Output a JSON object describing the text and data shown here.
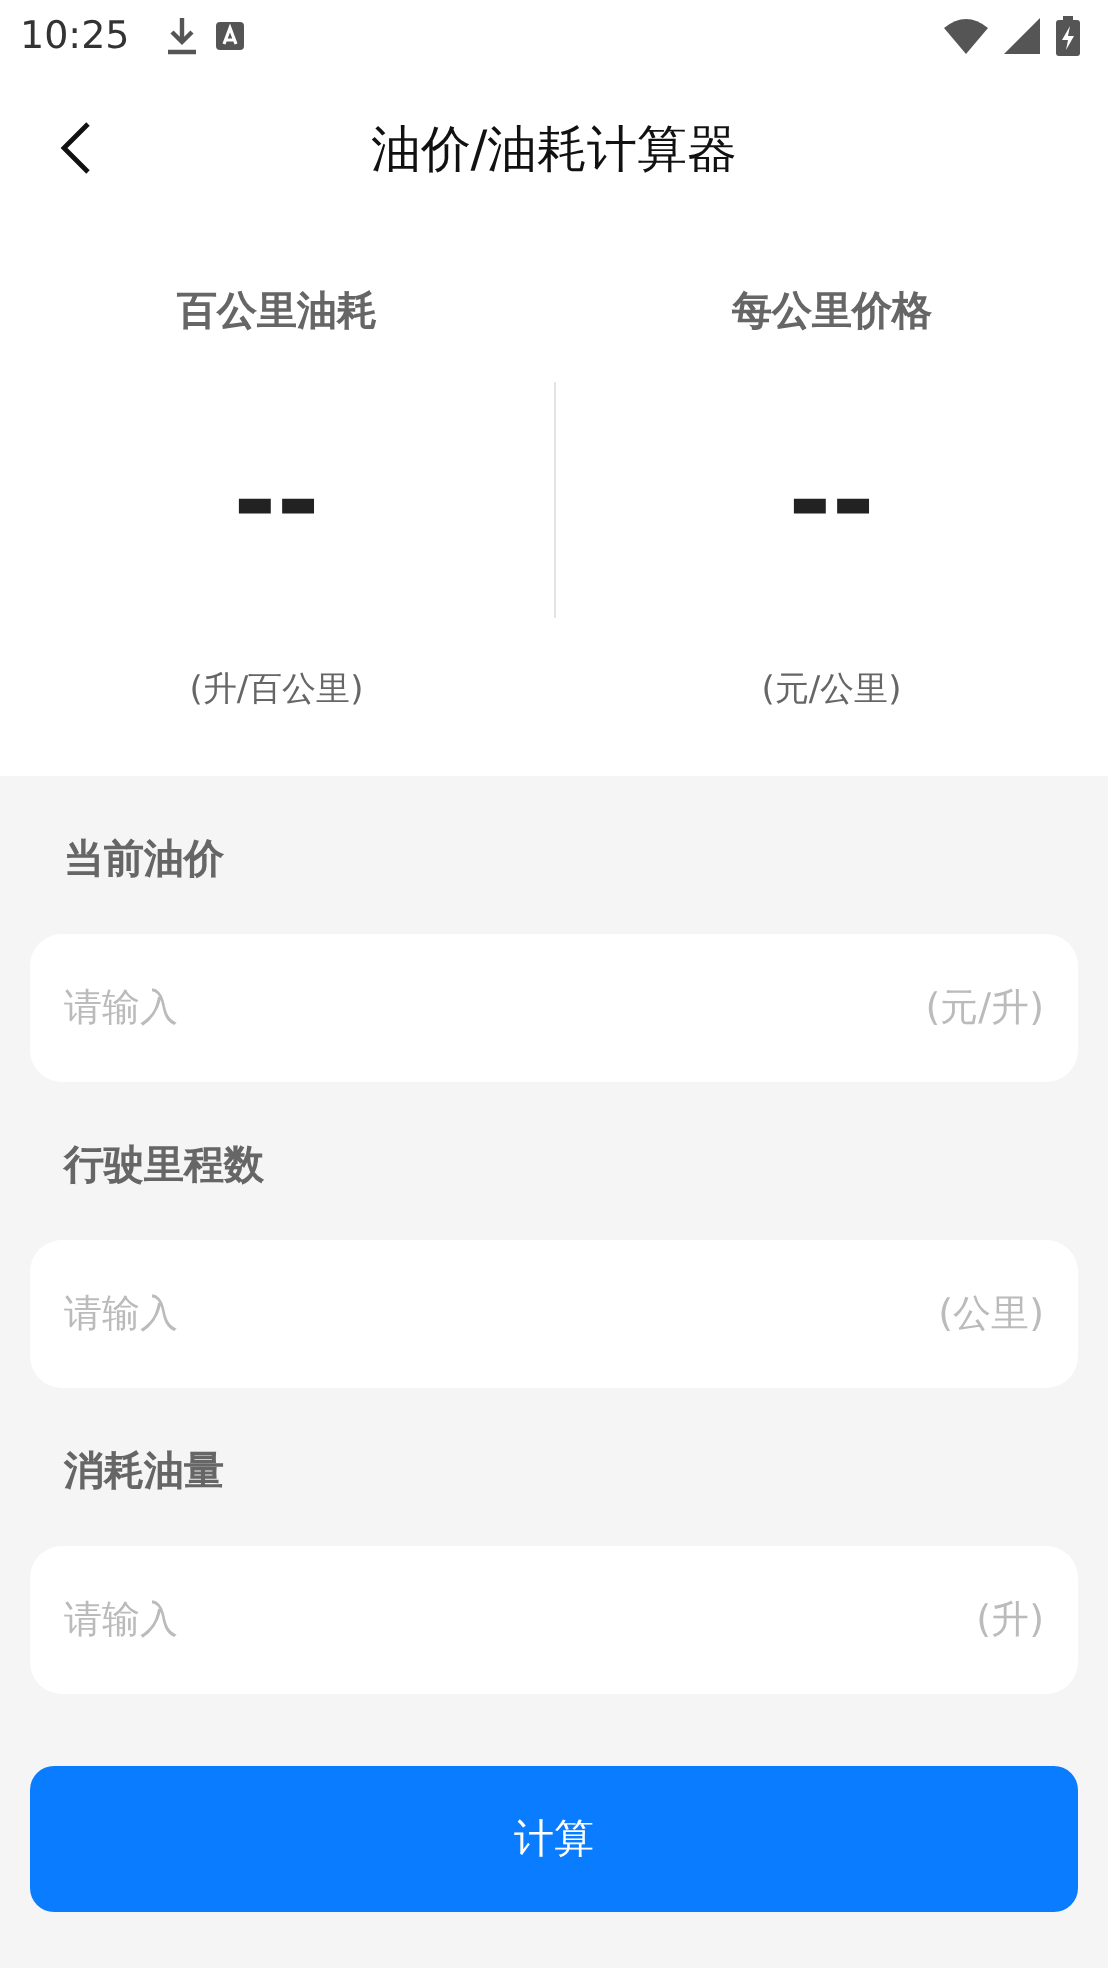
{
  "status_bar": {
    "time": "10:25"
  },
  "header": {
    "title": "油价/油耗计算器"
  },
  "results": [
    {
      "label": "百公里油耗",
      "value": "--",
      "unit": "(升/百公里)"
    },
    {
      "label": "每公里价格",
      "value": "--",
      "unit": "(元/公里)"
    }
  ],
  "fields": [
    {
      "label": "当前油价",
      "placeholder": "请输入",
      "unit": "(元/升)"
    },
    {
      "label": "行驶里程数",
      "placeholder": "请输入",
      "unit": "(公里)"
    },
    {
      "label": "消耗油量",
      "placeholder": "请输入",
      "unit": "(升)"
    }
  ],
  "button": "计算"
}
